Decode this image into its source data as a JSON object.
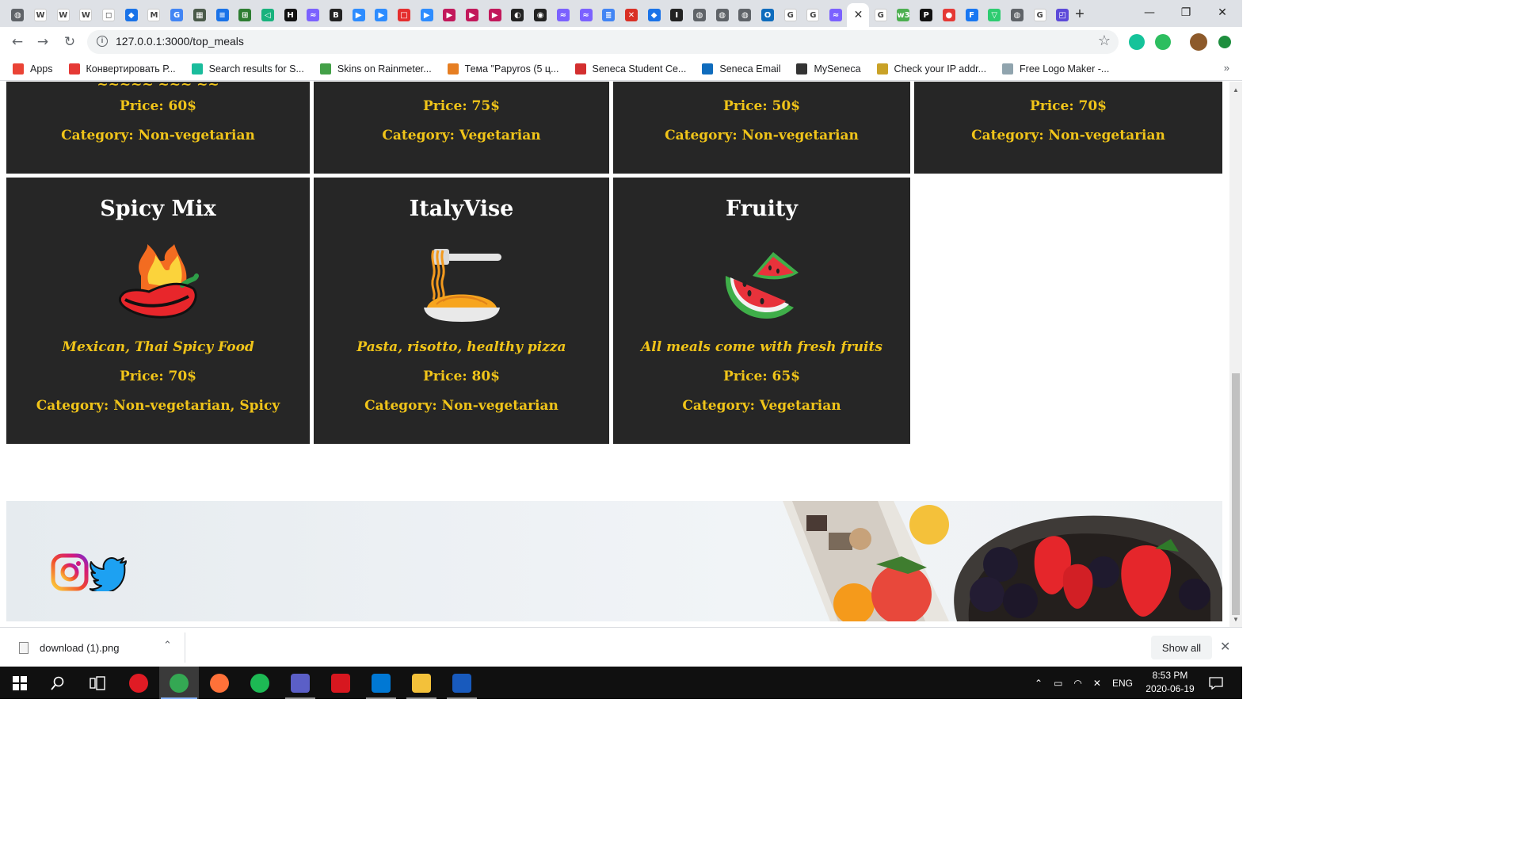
{
  "browser": {
    "tabs": [
      {
        "icon": "generic-globe-icon",
        "color": "#5f6368",
        "glyph": "◍"
      },
      {
        "icon": "wikipedia-icon",
        "color": "#ffffff",
        "glyph": "W"
      },
      {
        "icon": "wikipedia-icon",
        "color": "#ffffff",
        "glyph": "W"
      },
      {
        "icon": "wikipedia-icon",
        "color": "#ffffff",
        "glyph": "W"
      },
      {
        "icon": "document-icon",
        "color": "#ffffff",
        "glyph": "◻"
      },
      {
        "icon": "pocket-icon",
        "color": "#1a73e8",
        "glyph": "◆"
      },
      {
        "icon": "gmail-icon",
        "color": "#ffffff",
        "glyph": "M"
      },
      {
        "icon": "translate-icon",
        "color": "#4285f4",
        "glyph": "G"
      },
      {
        "icon": "image-icon",
        "color": "#4a5a4a",
        "glyph": "▦"
      },
      {
        "icon": "notes-icon",
        "color": "#1a73e8",
        "glyph": "≡"
      },
      {
        "icon": "cpp-icon",
        "color": "#2e7d32",
        "glyph": "⊞"
      },
      {
        "icon": "telegram-icon",
        "color": "#18b27d",
        "glyph": "◁"
      },
      {
        "icon": "hackernoon-icon",
        "color": "#111111",
        "glyph": "H"
      },
      {
        "icon": "wave-icon",
        "color": "#7b61ff",
        "glyph": "≈"
      },
      {
        "icon": "bb-icon",
        "color": "#222222",
        "glyph": "B"
      },
      {
        "icon": "zoom-icon",
        "color": "#2d8cff",
        "glyph": "▶"
      },
      {
        "icon": "zoom-icon",
        "color": "#2d8cff",
        "glyph": "▶"
      },
      {
        "icon": "notion-icon",
        "color": "#e52e2e",
        "glyph": "□"
      },
      {
        "icon": "zoom-icon",
        "color": "#2d8cff",
        "glyph": "▶"
      },
      {
        "icon": "play-icon",
        "color": "#c2185b",
        "glyph": "▶"
      },
      {
        "icon": "play-icon",
        "color": "#c2185b",
        "glyph": "▶"
      },
      {
        "icon": "play-icon",
        "color": "#c2185b",
        "glyph": "▶"
      },
      {
        "icon": "circular-icon",
        "color": "#222222",
        "glyph": "◐"
      },
      {
        "icon": "github-icon",
        "color": "#222222",
        "glyph": "◉"
      },
      {
        "icon": "wave-icon",
        "color": "#7b61ff",
        "glyph": "≈"
      },
      {
        "icon": "wave-icon",
        "color": "#7b61ff",
        "glyph": "≈"
      },
      {
        "icon": "docs-icon",
        "color": "#4285f4",
        "glyph": "≣"
      },
      {
        "icon": "error-icon",
        "color": "#d93025",
        "glyph": "✕"
      },
      {
        "icon": "pocket-icon",
        "color": "#1a73e8",
        "glyph": "◆"
      },
      {
        "icon": "ict-icon",
        "color": "#222222",
        "glyph": "I"
      },
      {
        "icon": "generic-globe-icon",
        "color": "#5f6368",
        "glyph": "◍"
      },
      {
        "icon": "generic-globe-icon",
        "color": "#5f6368",
        "glyph": "◍"
      },
      {
        "icon": "generic-globe-icon",
        "color": "#5f6368",
        "glyph": "◍"
      },
      {
        "icon": "outlook-icon",
        "color": "#0f6cbd",
        "glyph": "O"
      },
      {
        "icon": "google-icon",
        "color": "#ffffff",
        "glyph": "G"
      },
      {
        "icon": "google-icon",
        "color": "#ffffff",
        "glyph": "G"
      },
      {
        "icon": "wave-icon",
        "color": "#7b61ff",
        "glyph": "≈"
      },
      {
        "icon": "close-tab-icon",
        "color": "#ffffff",
        "glyph": "✕",
        "active": true
      },
      {
        "icon": "google-icon",
        "color": "#ffffff",
        "glyph": "G"
      },
      {
        "icon": "w3-icon",
        "color": "#4caf50",
        "glyph": "w3"
      },
      {
        "icon": "ip-icon",
        "color": "#111111",
        "glyph": "P"
      },
      {
        "icon": "opera-icon",
        "color": "#e53935",
        "glyph": "●"
      },
      {
        "icon": "facebook-icon",
        "color": "#1877f2",
        "glyph": "F"
      },
      {
        "icon": "vuetify-icon",
        "color": "#2ecc71",
        "glyph": "▽"
      },
      {
        "icon": "generic-globe-icon",
        "color": "#5f6368",
        "glyph": "◍"
      },
      {
        "icon": "google-icon",
        "color": "#ffffff",
        "glyph": "G"
      },
      {
        "icon": "app-icon",
        "color": "#5c4ad9",
        "glyph": "◰"
      }
    ],
    "url": "127.0.0.1:3000/top_meals",
    "bookmarks": [
      {
        "label": "Apps",
        "color": "#ea4335"
      },
      {
        "label": "Конвертировать Р...",
        "color": "#e53935"
      },
      {
        "label": "Search results for S...",
        "color": "#1abc9c"
      },
      {
        "label": "Skins on Rainmeter...",
        "color": "#43a047"
      },
      {
        "label": "Тема \"Papyros (5 ц...",
        "color": "#e67e22"
      },
      {
        "label": "Seneca Student Ce...",
        "color": "#d32f2f"
      },
      {
        "label": "Seneca Email",
        "color": "#0f6cbd"
      },
      {
        "label": "MySeneca",
        "color": "#333333"
      },
      {
        "label": "Check your IP addr...",
        "color": "#c9a227"
      },
      {
        "label": "Free Logo Maker -...",
        "color": "#90a4ae"
      }
    ]
  },
  "page": {
    "top_cards": [
      {
        "price": "Price: 60$",
        "category": "Category: Non-vegetarian"
      },
      {
        "price": "Price: 75$",
        "category": "Category: Vegetarian"
      },
      {
        "price": "Price: 50$",
        "category": "Category: Non-vegetarian"
      },
      {
        "price": "Price: 70$",
        "category": "Category: Non-vegetarian"
      }
    ],
    "cards": [
      {
        "title": "Spicy Mix",
        "desc": "Mexican, Thai Spicy Food",
        "price": "Price: 70$",
        "category": "Category: Non-vegetarian, Spicy",
        "icon": "chili-pepper-icon"
      },
      {
        "title": "ItalyVise",
        "desc": "Pasta, risotto, healthy pizza",
        "price": "Price: 80$",
        "category": "Category: Non-vegetarian",
        "icon": "pasta-fork-icon"
      },
      {
        "title": "Fruity",
        "desc": "All meals come with fresh fruits",
        "price": "Price: 65$",
        "category": "Category: Vegetarian",
        "icon": "watermelon-icon"
      }
    ],
    "colors": {
      "card_bg": "#262626",
      "accent": "#f0c419",
      "title": "#ffffff"
    }
  },
  "downloads": {
    "file": "download (1).png",
    "show_all": "Show all"
  },
  "taskbar": {
    "apps": [
      {
        "name": "opera-taskbar-icon",
        "color": "#e01b24"
      },
      {
        "name": "chrome-taskbar-icon",
        "color": "#34a853",
        "active": true
      },
      {
        "name": "firefox-taskbar-icon",
        "color": "#ff7139"
      },
      {
        "name": "spotify-taskbar-icon",
        "color": "#1db954"
      },
      {
        "name": "teams-taskbar-icon",
        "color": "#5b5fc7",
        "open": true
      },
      {
        "name": "acrobat-taskbar-icon",
        "color": "#d7171f"
      },
      {
        "name": "vscode-taskbar-icon",
        "color": "#0078d4",
        "open": true
      },
      {
        "name": "explorer-taskbar-icon",
        "color": "#f3c13a",
        "open": true
      },
      {
        "name": "word-taskbar-icon",
        "color": "#185abd",
        "open": true
      }
    ],
    "lang": "ENG",
    "time": "8:53 PM",
    "date": "2020-06-19"
  }
}
